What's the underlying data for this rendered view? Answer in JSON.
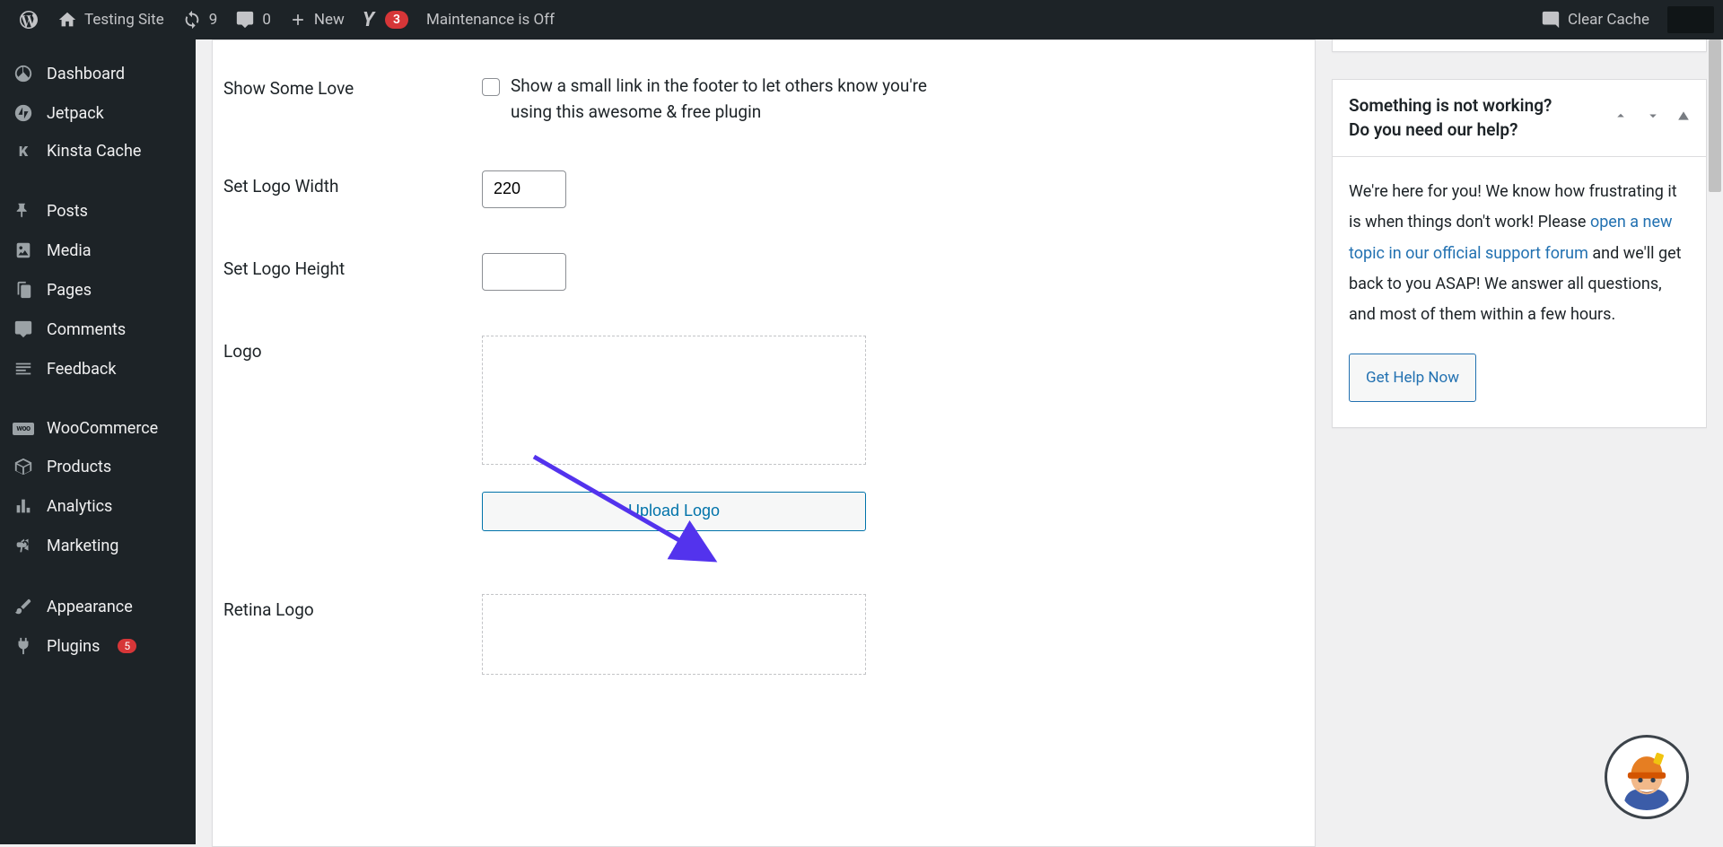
{
  "adminbar": {
    "site_title": "Testing Site",
    "updates_count": "9",
    "comments_count": "0",
    "new_label": "New",
    "yoast_count": "3",
    "maintenance": "Maintenance is Off",
    "clear_cache": "Clear Cache"
  },
  "sidebar": {
    "dashboard": "Dashboard",
    "jetpack": "Jetpack",
    "kinsta": "Kinsta Cache",
    "posts": "Posts",
    "media": "Media",
    "pages": "Pages",
    "comments": "Comments",
    "feedback": "Feedback",
    "woocommerce": "WooCommerce",
    "products": "Products",
    "analytics": "Analytics",
    "marketing": "Marketing",
    "appearance": "Appearance",
    "plugins": "Plugins",
    "plugins_count": "5"
  },
  "form": {
    "love_label": "Show Some Love",
    "love_text": "Show a small link in the footer to let others know you're using this awesome & free plugin",
    "width_label": "Set Logo Width",
    "width_value": "220",
    "height_label": "Set Logo Height",
    "height_value": "",
    "logo_label": "Logo",
    "upload_logo": "Upload Logo",
    "retina_label": "Retina Logo"
  },
  "helpbox": {
    "title_line1": "Something is not working?",
    "title_line2": "Do you need our help?",
    "body_part1": "We're here for you! We know how frustrating it is when things don't work! Please ",
    "link_text": "open a new topic in our official support forum",
    "body_part2": " and we'll get back to you ASAP! We answer all questions, and most of them within a few hours.",
    "button": "Get Help Now"
  }
}
